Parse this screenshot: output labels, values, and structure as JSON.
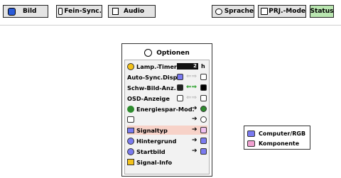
{
  "tabs": [
    {
      "label": "Bild",
      "icon": "picture-icon"
    },
    {
      "label": "Fein-Sync.",
      "icon": "fine-sync-icon"
    },
    {
      "label": "Audio",
      "icon": "speaker-icon"
    },
    {
      "label": "Sprache",
      "icon": "speech-bubble-icon"
    },
    {
      "label": "PRJ.-Mode",
      "icon": "projector-mode-icon"
    },
    {
      "label": "Status",
      "icon": "",
      "active": true
    }
  ],
  "menu": {
    "title": "Optionen",
    "title_icon": "options-icon",
    "items": [
      {
        "label": "Lamp.-Timer",
        "value": "2",
        "unit": "h"
      },
      {
        "label": "Auto-Sync.Disp"
      },
      {
        "label": "Schw-Bild-Anz."
      },
      {
        "label": "OSD-Anzeige"
      },
      {
        "label": "Energiespar-Mod."
      },
      {
        "label": ""
      },
      {
        "label": "Signaltyp"
      },
      {
        "label": "Hintergrund"
      },
      {
        "label": "Startbild"
      },
      {
        "label": "Signal-Info"
      }
    ]
  },
  "submenu": {
    "items": [
      {
        "label": "Computer/RGB"
      },
      {
        "label": "Komponente"
      }
    ]
  },
  "colors": {
    "active_tab": "#b9e6b0",
    "selected_row": "#f7d2c8",
    "icon_blue": "#2b5bd7",
    "icon_green": "#2e8b2e"
  }
}
